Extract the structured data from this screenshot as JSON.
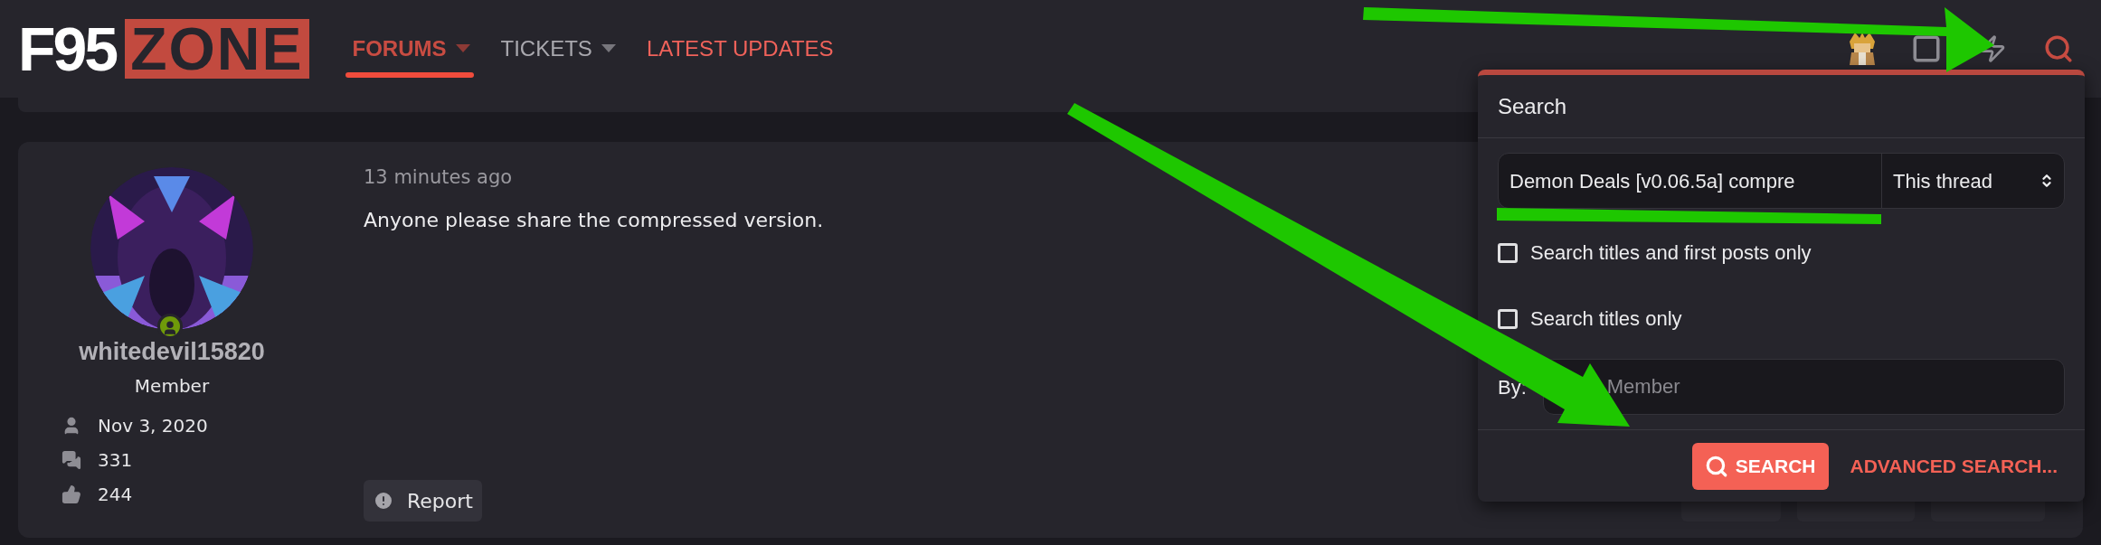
{
  "header": {
    "logo": {
      "left": "F95",
      "right": "ZONE"
    },
    "nav": [
      {
        "label": "FORUMS",
        "selected": true,
        "dropdown": true
      },
      {
        "label": "TICKETS",
        "selected": false,
        "dropdown": true
      },
      {
        "label": "LATEST UPDATES",
        "selected": false,
        "dropdown": false
      }
    ]
  },
  "post": {
    "author": {
      "name": "whitedevil15820",
      "role": "Member",
      "online": true
    },
    "stats": [
      {
        "kind": "joined",
        "text": "Nov 3, 2020"
      },
      {
        "kind": "messages",
        "text": "331"
      },
      {
        "kind": "reactions",
        "text": "244"
      }
    ],
    "time": "13 minutes ago",
    "body": "Anyone please share the compressed version.",
    "report": "Report"
  },
  "search_popup": {
    "title": "Search",
    "query": "Demon Deals [v0.06.5a] compre",
    "scope": "This thread",
    "options": [
      {
        "label": "Search titles and first posts only",
        "checked": false
      },
      {
        "label": "Search titles only",
        "checked": false
      }
    ],
    "by_label": "By:",
    "by_placeholder": "Member",
    "search_button": "SEARCH",
    "advanced_link": "ADVANCED SEARCH..."
  }
}
